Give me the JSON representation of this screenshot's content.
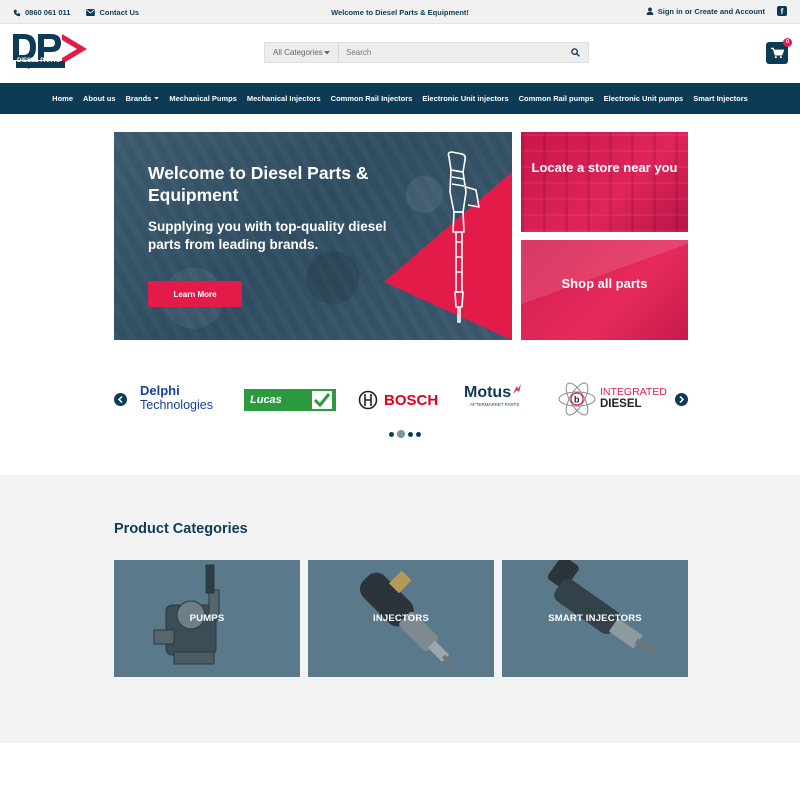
{
  "topbar": {
    "phone": "0860 061 011",
    "contact": "Contact Us",
    "welcome": "Welcome to Diesel Parts & Equipment!",
    "account": "Sign in or Create and Account"
  },
  "header": {
    "logo_text": "DIESEL PARTS",
    "logo_subtext": "& EQUIPMENT",
    "search_category": "All Categories",
    "search_placeholder": "Search",
    "cart_count": "0"
  },
  "nav": [
    "Home",
    "About us",
    "Brands",
    "Mechanical Pumps",
    "Mechanical Injectors",
    "Common Rail Injectors",
    "Electronic Unit injectors",
    "Common Rail pumps",
    "Electronic Unit pumps",
    "Smart Injectors"
  ],
  "hero": {
    "title": "Welcome to Diesel Parts & Equipment",
    "subtitle": "Supplying you with top-quality diesel parts from leading brands.",
    "button": "Learn More"
  },
  "promos": {
    "store": "Locate a store near you",
    "parts": "Shop all parts"
  },
  "brands": {
    "delphi_1": "Delphi",
    "delphi_2": "Technologies",
    "lucas": "Lucas",
    "bosch": "BOSCH",
    "motus": "Motus",
    "motus_sub": "AFTERMARKET PARTS",
    "integrated_1": "INTEGRATED",
    "integrated_2": "DIESEL"
  },
  "carousel": {
    "slide_count": 4,
    "active_index": 1
  },
  "categories": {
    "title": "Product Categories",
    "items": [
      "PUMPS",
      "INJECTORS",
      "SMART INJECTORS"
    ]
  },
  "colors": {
    "navy": "#0d3b55",
    "accent": "#e31b48",
    "card": "#5a7a8c"
  }
}
